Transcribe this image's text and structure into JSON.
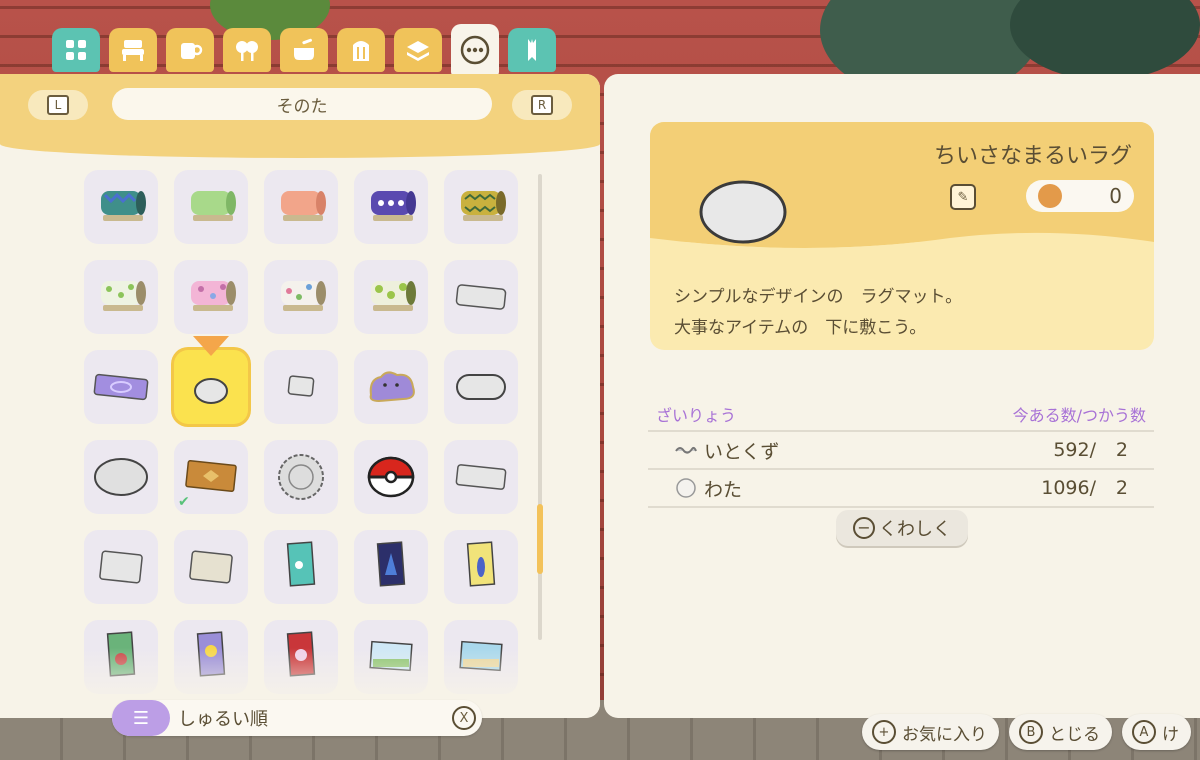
{
  "tabs": [
    {
      "name": "tab-all",
      "icon": "grid-icon"
    },
    {
      "name": "tab-furniture",
      "icon": "bed-icon"
    },
    {
      "name": "tab-small-items",
      "icon": "mug-icon"
    },
    {
      "name": "tab-outdoor",
      "icon": "tree-icon"
    },
    {
      "name": "tab-cooking",
      "icon": "pot-icon"
    },
    {
      "name": "tab-wall-mounted",
      "icon": "wall-icon"
    },
    {
      "name": "tab-flooring",
      "icon": "layer-icon"
    },
    {
      "name": "tab-other",
      "icon": "more-icon",
      "active": true
    },
    {
      "name": "tab-tools",
      "icon": "tool-icon"
    }
  ],
  "left": {
    "l_key": "L",
    "r_key": "R",
    "category": "そのた"
  },
  "grid_items": [
    "rug-roll-blue",
    "rug-roll-green",
    "rug-roll-orange",
    "rug-roll-purple",
    "rug-roll-yellow",
    "rug-roll-leaf-green",
    "rug-roll-pink",
    "rug-roll-white-dots",
    "rug-roll-lime",
    "rug-gray-rect",
    "rug-purple-rect",
    "rug-small-round-selected",
    "rug-small-square",
    "rug-ditto",
    "rug-gray-oval",
    "rug-gray-round",
    "rug-brown-pattern-owned",
    "rug-lace-round",
    "rug-pokeball",
    "rug-gray-rect-2",
    "rug-gray-rect-3",
    "rug-beige-rect",
    "poster-teal",
    "poster-dark",
    "poster-yellow",
    "poster-plant",
    "poster-sun",
    "poster-red",
    "poster-sky",
    "poster-landscape"
  ],
  "sort": {
    "label": "しゅるい順",
    "close_key": "X"
  },
  "detail": {
    "item_name": "ちいさなまるいラグ",
    "owned_count": "0",
    "description_line1": "シンプルなデザインの　ラグマット。",
    "description_line2": "大事なアイテムの　下に敷こう。",
    "materials_header": "ざいりょう",
    "materials_count_header": "今ある数/つかう数",
    "materials": [
      {
        "name": "いとくず",
        "have": "592/",
        "need": "2",
        "icon": "thread-icon"
      },
      {
        "name": "わた",
        "have": "1096/",
        "need": "2",
        "icon": "cotton-icon"
      }
    ],
    "detail_button": "くわしく",
    "detail_key": "−"
  },
  "bottom_buttons": {
    "favorite_key": "+",
    "favorite_label": "お気に入り",
    "close_key": "B",
    "close_label": "とじる",
    "a_key": "A",
    "a_label": "け"
  },
  "colors": {
    "header_yellow": "#f3d27e",
    "panel": "#f7f3e8",
    "material_header": "#a872d6",
    "selected_cell": "#fbe24e"
  }
}
